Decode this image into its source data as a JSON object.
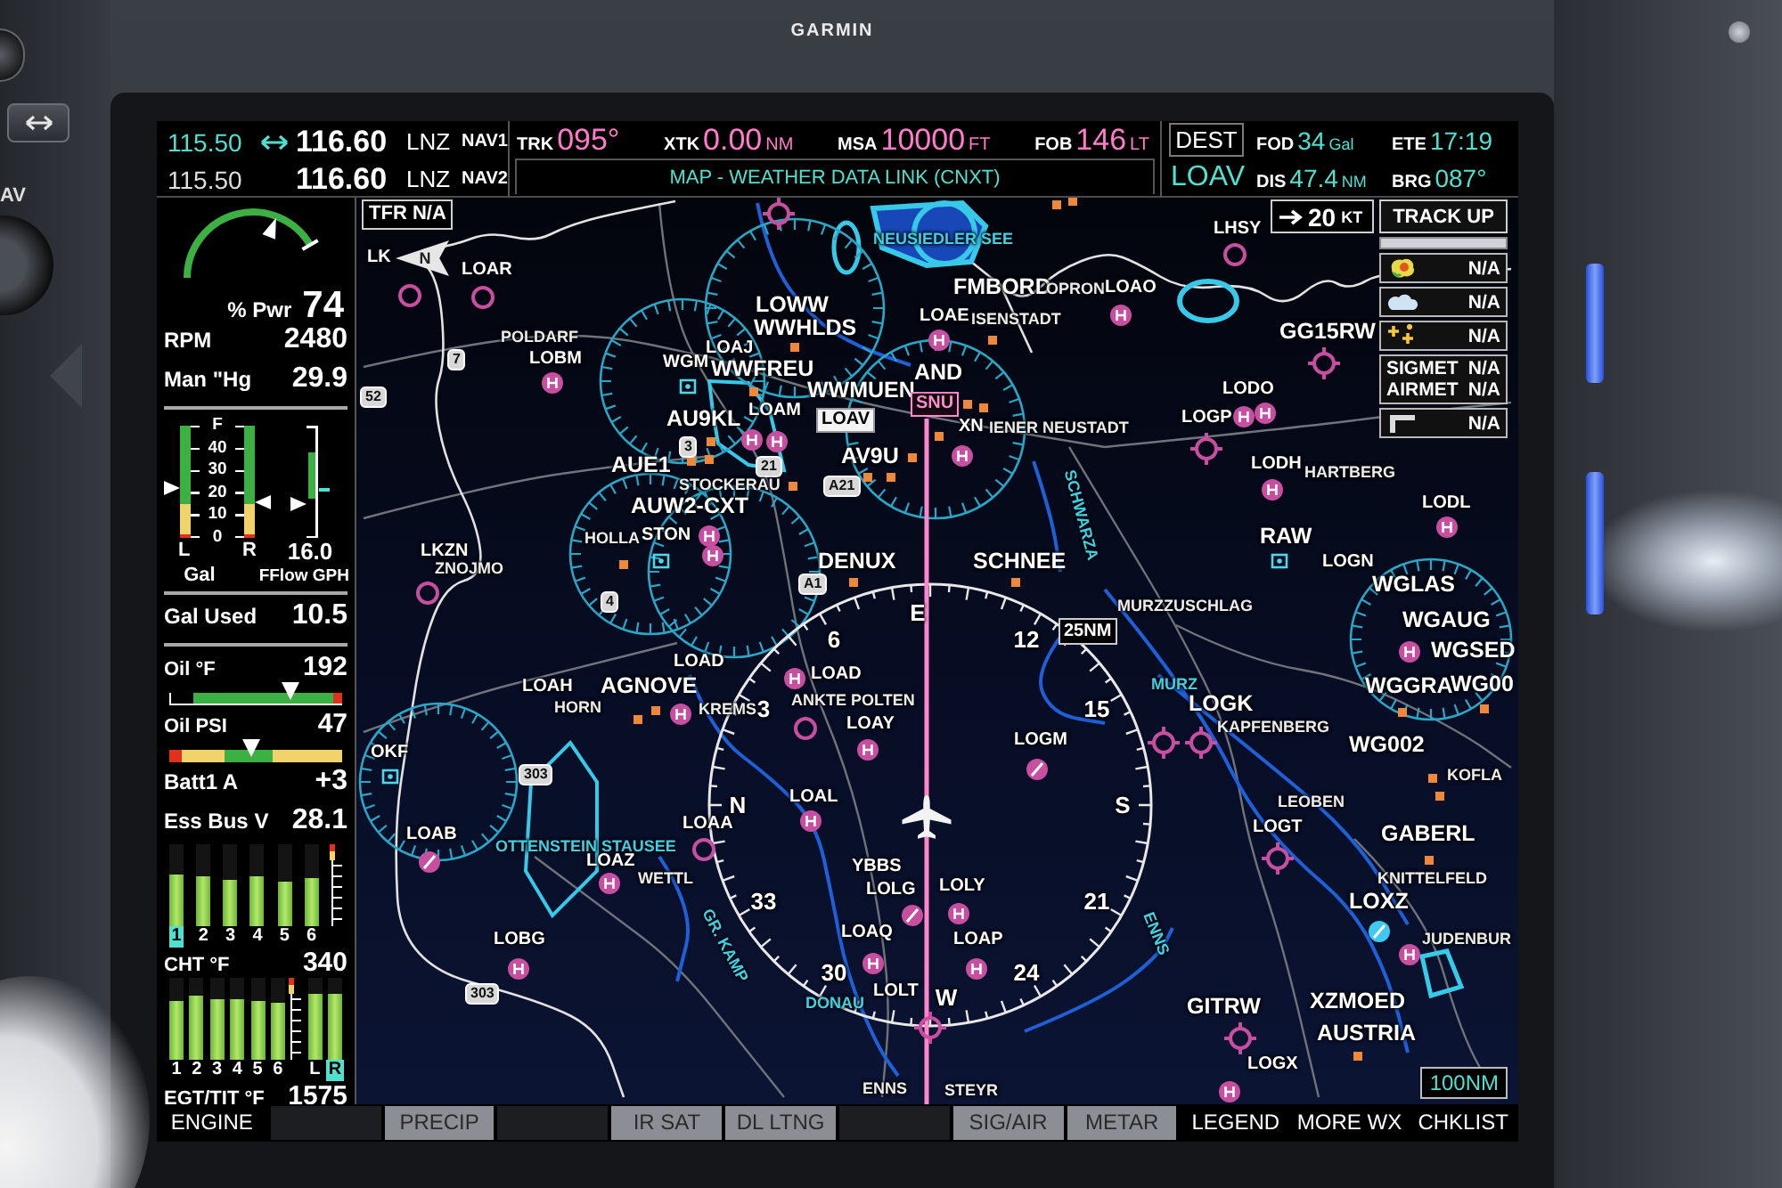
{
  "device": {
    "brand": "GARMIN",
    "bezel_label": "AV"
  },
  "top_bar": {
    "nav_radios": [
      {
        "standby": "115.50",
        "active": "116.60",
        "ident": "LNZ",
        "name": "NAV1",
        "selected": true
      },
      {
        "standby": "115.50",
        "active": "116.60",
        "ident": "LNZ",
        "name": "NAV2",
        "selected": false
      }
    ],
    "nav_data": [
      {
        "label": "TRK",
        "value": "095°"
      },
      {
        "label": "XTK",
        "value": "0.00",
        "unit": "NM"
      },
      {
        "label": "MSA",
        "value": "10000",
        "unit": "FT"
      },
      {
        "label": "FOB",
        "value": "146",
        "unit": "LT"
      }
    ],
    "page_title": "MAP - WEATHER DATA LINK (CNXT)",
    "destination": {
      "label": "DEST",
      "ident": "LOAV"
    },
    "dest_data": [
      {
        "label": "FOD",
        "value": "34",
        "unit": "Gal"
      },
      {
        "label": "ETE",
        "value": "17:19"
      },
      {
        "label": "DIS",
        "value": "47.4",
        "unit": "NM"
      },
      {
        "label": "BRG",
        "value": "087°"
      }
    ]
  },
  "engine": {
    "sections": [
      [
        {
          "kind": "arc",
          "label": "% Pwr",
          "value": "74",
          "level": 0.74
        },
        {
          "kind": "readout",
          "label": "RPM",
          "value": "2480"
        },
        {
          "kind": "readout",
          "label": "Man \"Hg",
          "value": "29.9"
        }
      ],
      [
        {
          "kind": "fuel",
          "scale": [
            "F",
            "40",
            "30",
            "20",
            "10",
            "0"
          ],
          "tanks": [
            {
              "label": "L",
              "level": 0.44
            },
            {
              "label": "R",
              "level": 0.32
            }
          ],
          "unit": "Gal",
          "flow": {
            "value": "16.0",
            "label": "FFlow GPH",
            "level": 0.3
          }
        }
      ],
      [
        {
          "kind": "readout",
          "label": "Gal Used",
          "value": "10.5"
        }
      ],
      [
        {
          "kind": "hbar",
          "label": "Oil °F",
          "value": "192",
          "level": 0.7
        },
        {
          "kind": "hbar",
          "label": "Oil PSI",
          "value": "47",
          "level": 0.47
        },
        {
          "kind": "readout",
          "label": "Batt1 A",
          "value": "+3"
        },
        {
          "kind": "readout",
          "label": "Ess Bus V",
          "value": "28.1"
        },
        {
          "kind": "bars",
          "label": "CHT °F",
          "value": "340",
          "bars": [
            {
              "kind": "cylinder",
              "label": "1",
              "level": 0.62,
              "selected": true
            },
            {
              "kind": "cylinder",
              "label": "2",
              "level": 0.6,
              "selected": false
            },
            {
              "kind": "cylinder",
              "label": "3",
              "level": 0.56,
              "selected": false
            },
            {
              "kind": "cylinder",
              "label": "4",
              "level": 0.6,
              "selected": false
            },
            {
              "kind": "cylinder",
              "label": "5",
              "level": 0.54,
              "selected": false
            },
            {
              "kind": "cylinder",
              "label": "6",
              "level": 0.58,
              "selected": false
            }
          ]
        },
        {
          "kind": "bars",
          "label": "EGT/TIT °F",
          "value": "1575",
          "bars": [
            {
              "kind": "cylinder",
              "label": "1",
              "level": 0.72,
              "selected": false
            },
            {
              "kind": "cylinder",
              "label": "2",
              "level": 0.78,
              "selected": false
            },
            {
              "kind": "cylinder",
              "label": "3",
              "level": 0.75,
              "selected": false
            },
            {
              "kind": "cylinder",
              "label": "4",
              "level": 0.75,
              "selected": false
            },
            {
              "kind": "cylinder",
              "label": "5",
              "level": 0.72,
              "selected": false
            },
            {
              "kind": "cylinder",
              "label": "6",
              "level": 0.7,
              "selected": false
            },
            {
              "kind": "tit",
              "label": "L",
              "level": 0.8,
              "selected": false
            },
            {
              "kind": "tit",
              "label": "R",
              "level": 0.8,
              "selected": true
            }
          ]
        }
      ]
    ]
  },
  "map": {
    "tfr": "TFR N/A",
    "wind": {
      "speed": "20",
      "unit": "KT"
    },
    "orientation": "TRACK UP",
    "north": "N",
    "range": "100NM",
    "compass": {
      "labels": [
        "E",
        "6",
        "12",
        "3",
        "15",
        "N",
        "S",
        "33",
        "21",
        "30",
        "24",
        "W"
      ],
      "range": "25NM"
    },
    "legend": [
      {
        "kind": "precip",
        "status": "N/A"
      },
      {
        "kind": "cloud",
        "status": "N/A"
      },
      {
        "kind": "lightning",
        "status": "N/A"
      },
      {
        "kind": "text",
        "lines": [
          {
            "label": "SIGMET",
            "status": "N/A"
          },
          {
            "label": "AIRMET",
            "status": "N/A"
          }
        ]
      },
      {
        "kind": "winds",
        "status": "N/A"
      }
    ],
    "labels": [
      {
        "text": "NEUSIEDLER SEE",
        "kind": "water"
      },
      {
        "text": "LHSY",
        "kind": "ident"
      },
      {
        "text": "LK",
        "kind": "ident"
      },
      {
        "text": "LOAR",
        "kind": "ident"
      },
      {
        "text": "FMBORD",
        "kind": "waypoint"
      },
      {
        "text": "OPRON",
        "kind": "city"
      },
      {
        "text": "LOAO",
        "kind": "ident"
      },
      {
        "text": "LOWW",
        "kind": "waypoint"
      },
      {
        "text": "POLDARF",
        "kind": "city"
      },
      {
        "text": "WWHLDS",
        "kind": "waypoint"
      },
      {
        "text": "LOAE",
        "kind": "ident"
      },
      {
        "text": "ISENSTADT",
        "kind": "city"
      },
      {
        "text": "GG15RW",
        "kind": "waypoint"
      },
      {
        "text": "LOAJ",
        "kind": "ident"
      },
      {
        "text": "7",
        "kind": "shield"
      },
      {
        "text": "LOBM",
        "kind": "ident"
      },
      {
        "text": "WGM",
        "kind": "ident"
      },
      {
        "text": "WWFREU",
        "kind": "waypoint"
      },
      {
        "text": "AND",
        "kind": "waypoint"
      },
      {
        "text": "52",
        "kind": "shield"
      },
      {
        "text": "WWMUEN",
        "kind": "waypoint"
      },
      {
        "text": "SNU",
        "kind": "navaid"
      },
      {
        "text": "LODO",
        "kind": "ident"
      },
      {
        "text": "AU9KL",
        "kind": "waypoint"
      },
      {
        "text": "LOAM",
        "kind": "ident"
      },
      {
        "text": "LOAV",
        "kind": "airport"
      },
      {
        "text": "XN",
        "kind": "ident"
      },
      {
        "text": "IENER NEUSTADT",
        "kind": "city"
      },
      {
        "text": "LOGP",
        "kind": "ident"
      },
      {
        "text": "3",
        "kind": "shield"
      },
      {
        "text": "AV9U",
        "kind": "waypoint"
      },
      {
        "text": "AUE1",
        "kind": "waypoint"
      },
      {
        "text": "21",
        "kind": "shield"
      },
      {
        "text": "SCHWARZA",
        "kind": "water"
      },
      {
        "text": "LODH",
        "kind": "ident"
      },
      {
        "text": "HARTBERG",
        "kind": "city"
      },
      {
        "text": "STOCKERAU",
        "kind": "city"
      },
      {
        "text": "A21",
        "kind": "shield"
      },
      {
        "text": "AUW2-CXT",
        "kind": "waypoint"
      },
      {
        "text": "LODL",
        "kind": "ident"
      },
      {
        "text": "HOLLA",
        "kind": "city"
      },
      {
        "text": "STON",
        "kind": "ident"
      },
      {
        "text": "RAW",
        "kind": "waypoint"
      },
      {
        "text": "LKZN",
        "kind": "ident"
      },
      {
        "text": "ZNOJMO",
        "kind": "city"
      },
      {
        "text": "DENUX",
        "kind": "waypoint"
      },
      {
        "text": "SCHNEE",
        "kind": "waypoint"
      },
      {
        "text": "LOGN",
        "kind": "ident"
      },
      {
        "text": "A1",
        "kind": "shield"
      },
      {
        "text": "WGLAS",
        "kind": "waypoint"
      },
      {
        "text": "4",
        "kind": "shield"
      },
      {
        "text": "MURZZUSCHLAG",
        "kind": "city"
      },
      {
        "text": "WGAUG",
        "kind": "waypoint"
      },
      {
        "text": "WGSED",
        "kind": "waypoint"
      },
      {
        "text": "LOAH",
        "kind": "ident"
      },
      {
        "text": "AGNOVE",
        "kind": "waypoint"
      },
      {
        "text": "LOAD",
        "kind": "ident"
      },
      {
        "text": "LOAD",
        "kind": "ident"
      },
      {
        "text": "MURZ",
        "kind": "water"
      },
      {
        "text": "WGGRA",
        "kind": "waypoint"
      },
      {
        "text": "WG00",
        "kind": "waypoint"
      },
      {
        "text": "HORN",
        "kind": "city"
      },
      {
        "text": "KREMS",
        "kind": "city"
      },
      {
        "text": "ANKTE POLTEN",
        "kind": "city"
      },
      {
        "text": "LOGK",
        "kind": "waypoint"
      },
      {
        "text": "LOAY",
        "kind": "ident"
      },
      {
        "text": "LOGM",
        "kind": "ident"
      },
      {
        "text": "KAPFENBERG",
        "kind": "city"
      },
      {
        "text": "WG002",
        "kind": "waypoint"
      },
      {
        "text": "OKF",
        "kind": "ident"
      },
      {
        "text": "303",
        "kind": "shield"
      },
      {
        "text": "KOFLA",
        "kind": "city"
      },
      {
        "text": "LOAL",
        "kind": "ident"
      },
      {
        "text": "LEOBEN",
        "kind": "city"
      },
      {
        "text": "LOAB",
        "kind": "ident"
      },
      {
        "text": "LOAA",
        "kind": "ident"
      },
      {
        "text": "LOGT",
        "kind": "ident"
      },
      {
        "text": "GABERL",
        "kind": "waypoint"
      },
      {
        "text": "OTTENSTEIN STAUSEE",
        "kind": "water"
      },
      {
        "text": "LOAZ",
        "kind": "ident"
      },
      {
        "text": "YBBS",
        "kind": "ident"
      },
      {
        "text": "WETTL",
        "kind": "city"
      },
      {
        "text": "GR. KAMP",
        "kind": "water"
      },
      {
        "text": "LOLG",
        "kind": "ident"
      },
      {
        "text": "LOLY",
        "kind": "ident"
      },
      {
        "text": "KNITTELFELD",
        "kind": "city"
      },
      {
        "text": "LOXZ",
        "kind": "waypoint"
      },
      {
        "text": "LOBG",
        "kind": "ident"
      },
      {
        "text": "LOAQ",
        "kind": "ident"
      },
      {
        "text": "LOAP",
        "kind": "ident"
      },
      {
        "text": "ENNS",
        "kind": "water"
      },
      {
        "text": "JUDENBUR",
        "kind": "city"
      },
      {
        "text": "303",
        "kind": "shield"
      },
      {
        "text": "DONAU",
        "kind": "water"
      },
      {
        "text": "LOLT",
        "kind": "ident"
      },
      {
        "text": "GITRW",
        "kind": "waypoint"
      },
      {
        "text": "XZMOED",
        "kind": "waypoint"
      },
      {
        "text": "AUSTRIA",
        "kind": "waypoint"
      },
      {
        "text": "LOGX",
        "kind": "ident"
      },
      {
        "text": "ENNS",
        "kind": "city"
      },
      {
        "text": "STEYR",
        "kind": "city"
      }
    ]
  },
  "softkeys": [
    {
      "label": "ENGINE",
      "on": false
    },
    {
      "on": false
    },
    {
      "label": "PRECIP",
      "on": true
    },
    {
      "on": false
    },
    {
      "label": "IR SAT",
      "on": true
    },
    {
      "label": "DL LTNG",
      "on": true
    },
    {
      "on": false
    },
    {
      "label": "SIG/AIR",
      "on": true
    },
    {
      "label": "METAR",
      "on": true
    },
    {
      "label": "LEGEND",
      "on": false
    },
    {
      "label": "MORE WX",
      "on": false
    },
    {
      "label": "CHKLIST",
      "on": false
    }
  ]
}
